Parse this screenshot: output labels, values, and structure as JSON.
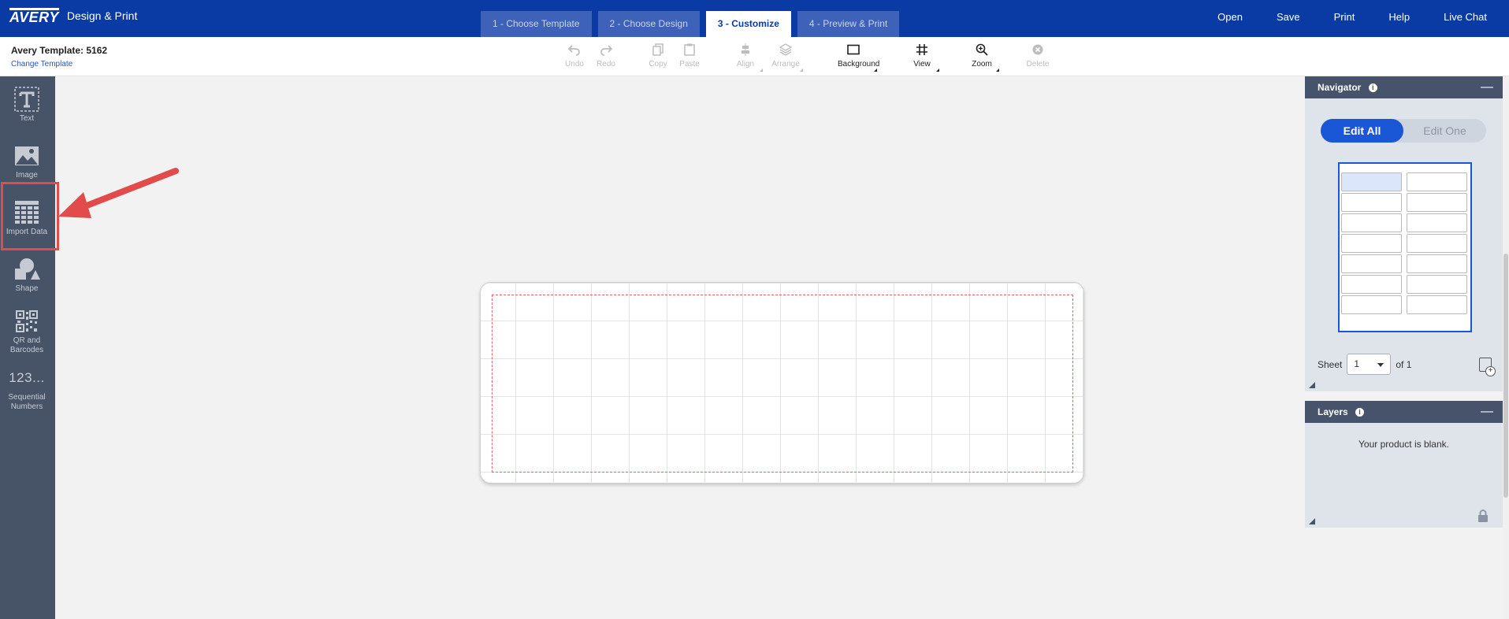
{
  "header": {
    "brand": "AVERY",
    "app_name": "Design & Print",
    "steps": [
      {
        "label": "1 - Choose Template",
        "active": false
      },
      {
        "label": "2 - Choose Design",
        "active": false
      },
      {
        "label": "3 - Customize",
        "active": true
      },
      {
        "label": "4 - Preview & Print",
        "active": false
      }
    ],
    "nav": [
      "Open",
      "Save",
      "Print",
      "Help",
      "Live Chat"
    ]
  },
  "template": {
    "title": "Avery Template: 5162",
    "change_link": "Change Template"
  },
  "toolbar": {
    "undo": "Undo",
    "redo": "Redo",
    "copy": "Copy",
    "paste": "Paste",
    "align": "Align",
    "arrange": "Arrange",
    "background": "Background",
    "view": "View",
    "zoom": "Zoom",
    "delete": "Delete"
  },
  "sidebar": {
    "items": [
      {
        "label": "Text",
        "icon": "text-icon"
      },
      {
        "label": "Image",
        "icon": "image-icon"
      },
      {
        "label": "Import Data",
        "icon": "grid-table-icon"
      },
      {
        "label": "Shape",
        "icon": "shape-icon"
      },
      {
        "label": "QR and Barcodes",
        "icon": "qr-code-icon"
      },
      {
        "label": "Sequential Numbers",
        "glyph": "123..."
      }
    ]
  },
  "navigator": {
    "title": "Navigator",
    "edit_all": "Edit All",
    "edit_one": "Edit One",
    "sheet_label": "Sheet",
    "sheet_value": "1",
    "sheet_of": "of 1"
  },
  "layers": {
    "title": "Layers",
    "empty_message": "Your product is blank."
  },
  "colors": {
    "brand_blue": "#0a3ba4",
    "accent_blue": "#1a57d6",
    "highlight_red": "#e14b4b",
    "sidebar": "#475467"
  }
}
